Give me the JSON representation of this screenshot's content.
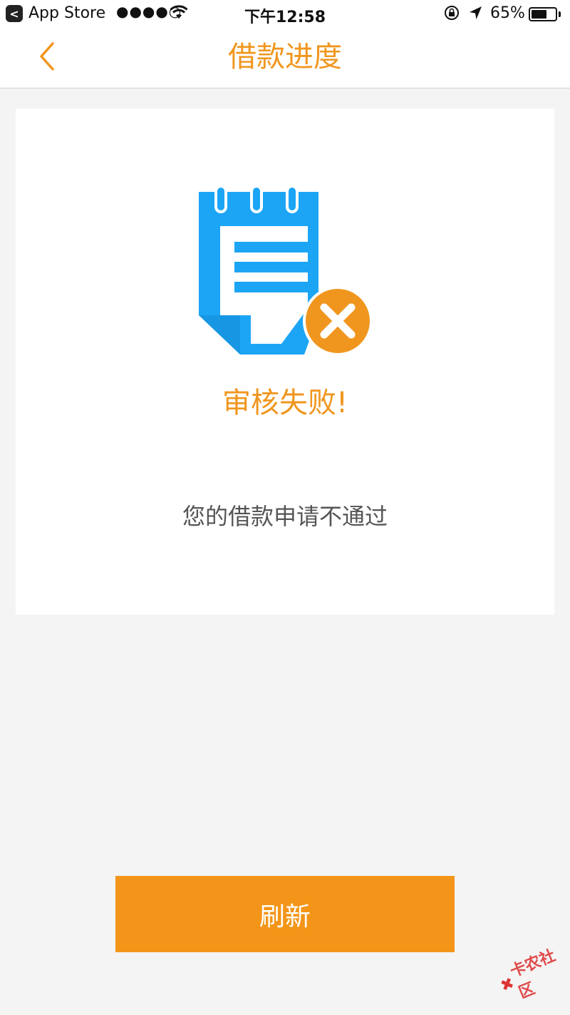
{
  "status_bar": {
    "back_badge": "<",
    "app_name": "App Store",
    "signal": "●●●●○",
    "time": "下午12:58",
    "battery": "65%",
    "battery_level_percent": 65
  },
  "nav": {
    "title": "借款进度",
    "back_icon": "chevron-left-icon"
  },
  "result": {
    "title": "审核失败!",
    "message": "您的借款申请不通过",
    "icon": "notepad-rejected-icon"
  },
  "actions": {
    "refresh_label": "刷新"
  },
  "watermark": {
    "text": "卡农社区"
  },
  "colors": {
    "accent": "#f0961e",
    "button": "#f39518",
    "icon_blue": "#1da5f5",
    "background": "#f4f4f4"
  }
}
